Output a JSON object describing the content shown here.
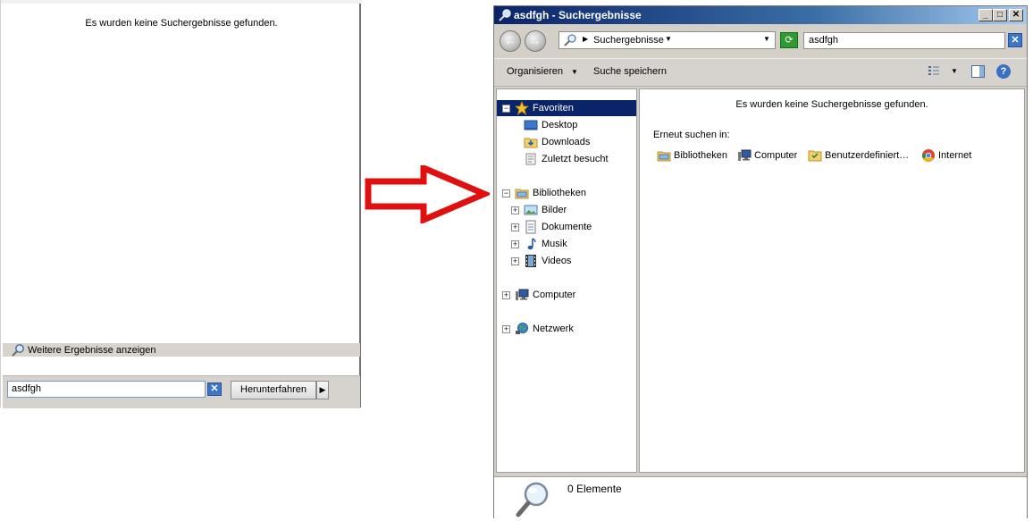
{
  "start_menu": {
    "no_results": "Es wurden keine Suchergebnisse gefunden.",
    "more_results": "Weitere Ergebnisse anzeigen",
    "search_value": "asdfgh",
    "shutdown_label": "Herunterfahren"
  },
  "explorer": {
    "title": "asdfgh - Suchergebnisse",
    "address_crumb": "Suchergebnisse",
    "search_value": "asdfgh",
    "toolbar": {
      "organize": "Organisieren",
      "save_search": "Suche speichern"
    },
    "nav": {
      "favorites": "Favoriten",
      "desktop": "Desktop",
      "downloads": "Downloads",
      "recent": "Zuletzt besucht",
      "libraries": "Bibliotheken",
      "pictures": "Bilder",
      "documents": "Dokumente",
      "music": "Musik",
      "videos": "Videos",
      "computer": "Computer",
      "network": "Netzwerk"
    },
    "content": {
      "no_results": "Es wurden keine Suchergebnisse gefunden.",
      "search_again": "Erneut suchen in:",
      "locations": [
        "Bibliotheken",
        "Computer",
        "Benutzerdefiniert…",
        "Internet"
      ]
    },
    "status": "0 Elemente"
  },
  "colors": {
    "arrow": "#e01010",
    "title_bar": "#0a246a",
    "selection": "#0a246a"
  }
}
